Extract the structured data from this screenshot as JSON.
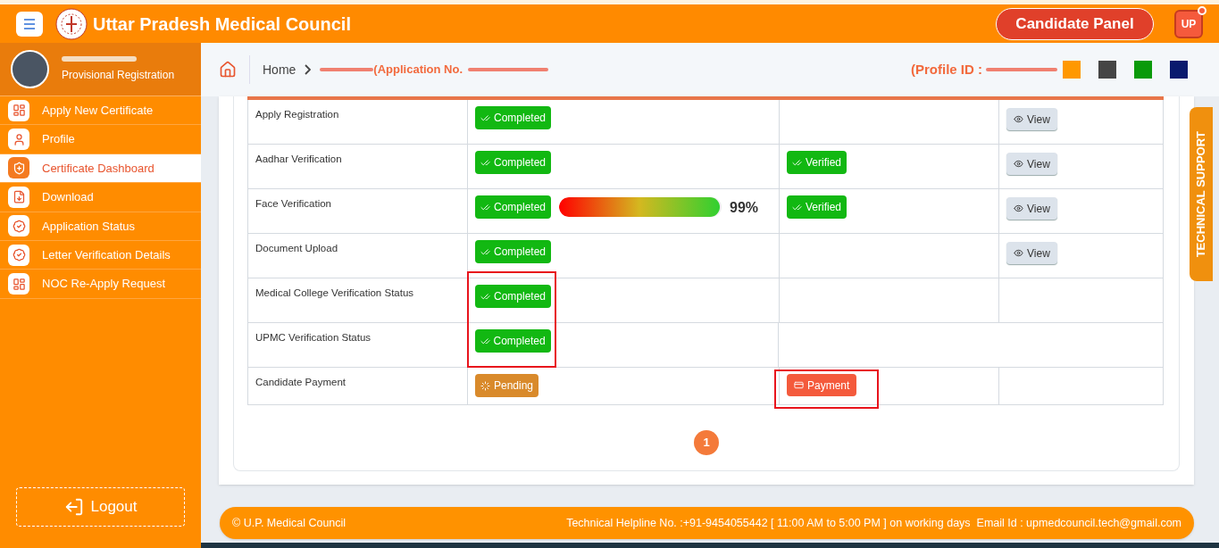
{
  "header": {
    "title": "Uttar Pradesh Medical Council",
    "panel_button": "Candidate Panel",
    "user_badge": "UP",
    "notification": true
  },
  "profile": {
    "subtitle": "Provisional Registration"
  },
  "sidebar": {
    "items": [
      {
        "label": "Apply New Certificate",
        "selected": false
      },
      {
        "label": "Profile",
        "selected": false
      },
      {
        "label": "Certificate Dashboard",
        "selected": true
      },
      {
        "label": "Download",
        "selected": false
      },
      {
        "label": "Application Status",
        "selected": false
      },
      {
        "label": "Letter Verification Details",
        "selected": false
      },
      {
        "label": "NOC Re-Apply Request",
        "selected": false
      }
    ],
    "logout": "Logout"
  },
  "breadcrumb": {
    "home": "Home",
    "application": "(Application No.",
    "profile_id": "(Profile ID :"
  },
  "table": {
    "rows": [
      {
        "label": "Apply Registration",
        "status": {
          "text": "Completed",
          "kind": "completed",
          "highlight": false
        },
        "action": {
          "text": "View",
          "kind": "view",
          "highlight": false
        }
      },
      {
        "label": "Aadhar Verification",
        "status": {
          "text": "Completed",
          "kind": "completed",
          "highlight": false
        },
        "verification": "Verified",
        "action": {
          "text": "View",
          "kind": "view",
          "highlight": false
        }
      },
      {
        "label": "Face Verification",
        "status": {
          "text": "Completed",
          "kind": "completed",
          "highlight": false
        },
        "progress": {
          "level": 0.99,
          "text": "99%"
        },
        "verification": "Verified",
        "action": {
          "text": "View",
          "kind": "view",
          "highlight": false
        }
      },
      {
        "label": "Document Upload",
        "status": {
          "text": "Completed",
          "kind": "completed",
          "highlight": false
        },
        "action": {
          "text": "View",
          "kind": "view",
          "highlight": false
        }
      },
      {
        "label": "Medical College Verification Status",
        "status": {
          "text": "Completed",
          "kind": "completed",
          "highlight": true
        }
      },
      {
        "label": "UPMC Verification Status",
        "status": {
          "text": "Completed",
          "kind": "completed",
          "highlight": true
        },
        "merged": true
      },
      {
        "label": "Candidate Payment",
        "status": {
          "text": "Pending",
          "kind": "pending",
          "highlight": false
        },
        "action": {
          "text": "Payment",
          "kind": "payment",
          "highlight": true
        }
      }
    ]
  },
  "pagination": [
    {
      "label": "1",
      "selected": true
    }
  ],
  "support_tab": "TECHNICAL SUPPORT",
  "footer": {
    "copyright": "© U.P. Medical Council",
    "helpline": "Technical Helpline No. :+91-9454055442 [ 11:00 AM to 5:00 PM ] on working days  Email Id : upmedcouncil.tech@gmail.com"
  }
}
